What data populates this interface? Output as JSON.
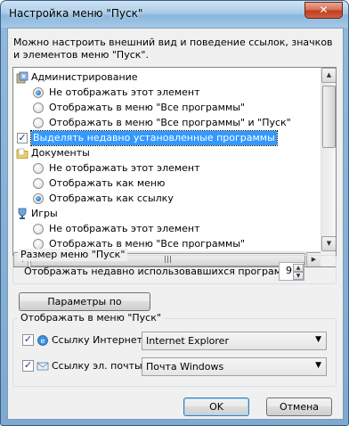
{
  "window": {
    "title": "Настройка меню \"Пуск\"",
    "close_glyph": "✕"
  },
  "intro": "Можно настроить внешний вид и поведение ссылок, значков и элементов меню \"Пуск\".",
  "list": {
    "cat_admin": "Администрирование",
    "admin_opt1": "Не отображать этот элемент",
    "admin_opt2": "Отображать в меню \"Все программы\"",
    "admin_opt3": "Отображать в меню \"Все программы\" и \"Пуск\"",
    "highlight_new": "Выделять недавно установленные программы",
    "cat_docs": "Документы",
    "docs_opt1": "Не отображать этот элемент",
    "docs_opt2": "Отображать как меню",
    "docs_opt3": "Отображать как ссылку",
    "cat_games": "Игры",
    "games_opt1": "Не отображать этот элемент",
    "games_opt2": "Отображать в меню \"Все программы\""
  },
  "menu_size": {
    "group_title": "Размер меню \"Пуск\"",
    "recent_label": "Отображать недавно использовавшихся программ:",
    "recent_value": "9"
  },
  "defaults_button": "Параметры по умолчанию",
  "show_in_menu": {
    "group_title": "Отображать в меню \"Пуск\"",
    "internet_label": "Ссылку Интернета:",
    "internet_value": "Internet Explorer",
    "email_label": "Ссылку эл. почты:",
    "email_value": "Почта Windows"
  },
  "buttons": {
    "ok": "OK",
    "cancel": "Отмена"
  },
  "icons": {
    "admin": "admin-tools-icon",
    "docs": "folder-icon",
    "games": "trophy-icon",
    "internet": "internet-explorer-icon",
    "email": "windows-mail-icon"
  }
}
